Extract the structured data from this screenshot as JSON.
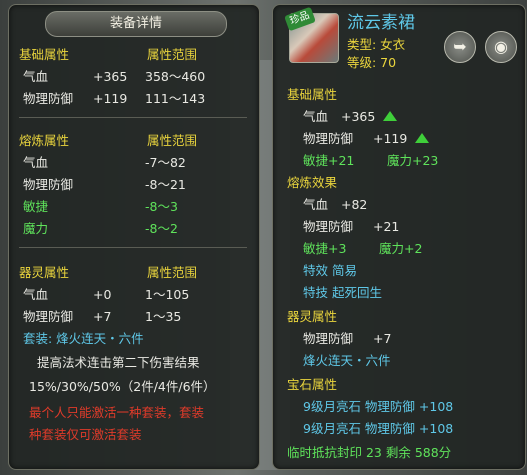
{
  "left": {
    "title": "装备详情",
    "base_header": {
      "name": "基础属性",
      "range": "属性范围"
    },
    "base_rows": [
      {
        "name": "气血",
        "value": "+365",
        "range": "358～460"
      },
      {
        "name": "物理防御",
        "value": "+119",
        "range": "111～143"
      }
    ],
    "forge_header": {
      "name": "熔炼属性",
      "range": "属性范围"
    },
    "forge_rows": [
      {
        "name": "气血",
        "range": "-7～82"
      },
      {
        "name": "物理防御",
        "range": "-8～21"
      },
      {
        "name": "敏捷",
        "range": "-8～3"
      },
      {
        "name": "魔力",
        "range": "-8～2"
      }
    ],
    "spirit_header": {
      "name": "器灵属性",
      "range": "属性范围"
    },
    "spirit_rows": [
      {
        "name": "气血",
        "value": "+0",
        "range": "1～105"
      },
      {
        "name": "物理防御",
        "value": "+7",
        "range": "1～35"
      }
    ],
    "set_label": "套装: 烽火连天・六件",
    "set_desc": "提高法术连击第二下伤害结果",
    "set_values": "15%/30%/50%（2件/4件/6件）",
    "red_line1": "最个人只能激活一种套装，套装",
    "red_line2": "种套装仅可激活套装"
  },
  "right": {
    "item_name": "流云素裙",
    "badge": "珍品",
    "type_label": "类型: 女衣",
    "level_label": "等级: 70",
    "base_header": "基础属性",
    "base_rows": [
      {
        "name": "气血",
        "value": "+365"
      },
      {
        "name": "物理防御",
        "value": "+119"
      }
    ],
    "base_green": [
      "敏捷+21",
      "魔力+23"
    ],
    "forge_header": "熔炼效果",
    "forge_rows": [
      {
        "name": "气血",
        "value": "+82"
      },
      {
        "name": "物理防御",
        "value": "+21"
      }
    ],
    "forge_green": [
      "敏捷+3",
      "魔力+2"
    ],
    "special_effect": "特效  简易",
    "special_skill": "特技  起死回生",
    "spirit_header": "器灵属性",
    "spirit_row": {
      "name": "物理防御",
      "value": "+7"
    },
    "set_name": "烽火连天・六件",
    "gem_header": "宝石属性",
    "gem_rows": [
      "9级月亮石  物理防御  +108",
      "9级月亮石  物理防御  +108"
    ],
    "seal_line": "临时抵抗封印  23  剩余  588分",
    "share_icon": "share-icon",
    "view_icon": "eye-icon"
  }
}
